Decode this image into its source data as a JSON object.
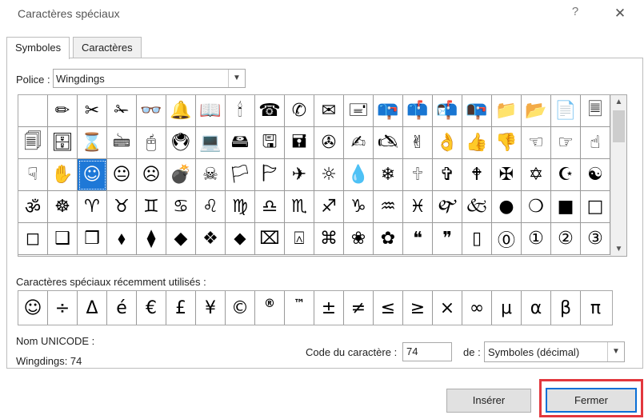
{
  "window": {
    "title": "Caractères spéciaux",
    "help": "?",
    "close": "✕"
  },
  "tabs": [
    {
      "label": "Symboles",
      "active": true
    },
    {
      "label": "Caractères spéciaux",
      "active": false
    }
  ],
  "font": {
    "label": "Police :",
    "value": "Wingdings"
  },
  "symbols": [
    "",
    "✏",
    "✂",
    "✁",
    "👓",
    "🔔",
    "📖",
    "🕯",
    "☎",
    "✆",
    "✉",
    "🖃",
    "📪",
    "📫",
    "📬",
    "📭",
    "📁",
    "📂",
    "📄",
    "🗏",
    "🗐",
    "🗄",
    "⌛",
    "🖮",
    "🖰",
    "🖲",
    "💻",
    "🖴",
    "🖫",
    "🖬",
    "✇",
    "✍",
    "🖎",
    "✌",
    "👌",
    "👍",
    "👎",
    "☜",
    "☞",
    "☝",
    "☟",
    "✋",
    "☺",
    "😐",
    "☹",
    "💣",
    "☠",
    "🏳",
    "🏱",
    "✈",
    "☼",
    "💧",
    "❄",
    "🕆",
    "✞",
    "🕈",
    "✠",
    "✡",
    "☪",
    "☯",
    "ॐ",
    "☸",
    "♈",
    "♉",
    "♊",
    "♋",
    "♌",
    "♍",
    "♎",
    "♏",
    "♐",
    "♑",
    "♒",
    "♓",
    "🙰",
    "🙵",
    "●",
    "❍",
    "■",
    "□",
    "◻",
    "❑",
    "❒",
    "⬧",
    "⧫",
    "◆",
    "❖",
    "⬥",
    "⌧",
    "⍓",
    "⌘",
    "❀",
    "✿",
    "❝",
    "❞",
    "▯",
    "⓪",
    "①",
    "②",
    "③"
  ],
  "recent": {
    "label": "Caractères spéciaux récemment utilisés :",
    "chars": [
      "☺",
      "÷",
      "Δ",
      "é",
      "€",
      "£",
      "¥",
      "©",
      "®",
      "™",
      "±",
      "≠",
      "≤",
      "≥",
      "×",
      "∞",
      "μ",
      "α",
      "β",
      "π"
    ]
  },
  "unicode": {
    "label": "Nom UNICODE :",
    "value": "Wingdings: 74"
  },
  "code": {
    "label": "Code du caractère :",
    "value": "74"
  },
  "from": {
    "label": "de :",
    "value": "Symboles (décimal)"
  },
  "buttons": {
    "insert": "Insérer",
    "close": "Fermer"
  },
  "selected_index": 42,
  "colors": {
    "selection": "#1e78d7",
    "highlight_outline": "#e2373d",
    "focus_border": "#0a6fd6"
  }
}
